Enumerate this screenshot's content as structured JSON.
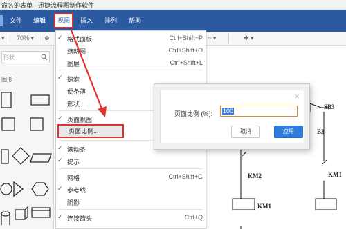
{
  "window": {
    "title": "命名的表单 - 迅捷流程图制作软件"
  },
  "menubar": {
    "items": [
      {
        "label": "文件"
      },
      {
        "label": "编辑"
      },
      {
        "label": "视图"
      },
      {
        "label": "插入"
      },
      {
        "label": "排列"
      },
      {
        "label": "帮助"
      }
    ]
  },
  "toolbar": {
    "zoom": "70%"
  },
  "left_panel": {
    "search_placeholder": "形状",
    "category": "图形"
  },
  "view_menu": {
    "items": [
      {
        "label": "格式面板",
        "shortcut": "Ctrl+Shift+P",
        "checked": true
      },
      {
        "label": "缩略图",
        "shortcut": "Ctrl+Shift+O",
        "checked": false
      },
      {
        "label": "图层",
        "shortcut": "Ctrl+Shift+L",
        "checked": false
      },
      {
        "label": "搜索",
        "shortcut": "",
        "checked": true
      },
      {
        "label": "便条薄",
        "shortcut": "",
        "checked": false
      },
      {
        "label": "形状...",
        "shortcut": "",
        "checked": false
      },
      {
        "label": "页面视图",
        "shortcut": "",
        "checked": true
      },
      {
        "label": "页面比例...",
        "shortcut": "",
        "checked": false
      },
      {
        "label": "滚动条",
        "shortcut": "",
        "checked": true
      },
      {
        "label": "提示",
        "shortcut": "",
        "checked": true
      },
      {
        "label": "网格",
        "shortcut": "Ctrl+Shift+G",
        "checked": false
      },
      {
        "label": "参考线",
        "shortcut": "",
        "checked": true
      },
      {
        "label": "阴影",
        "shortcut": "",
        "checked": false
      },
      {
        "label": "连接箭头",
        "shortcut": "Ctrl+Q",
        "checked": true
      }
    ]
  },
  "dialog": {
    "label": "页面比例 (%):",
    "value": "100",
    "cancel_label": "取消",
    "ok_label": "应用"
  },
  "canvas": {
    "labels": [
      "SB3",
      "B3",
      "KM2",
      "KM1",
      "KM1"
    ]
  },
  "colors": {
    "menubar": "#2c5aa0",
    "highlight": "#e03030",
    "primary_button": "#2f7bdb"
  }
}
